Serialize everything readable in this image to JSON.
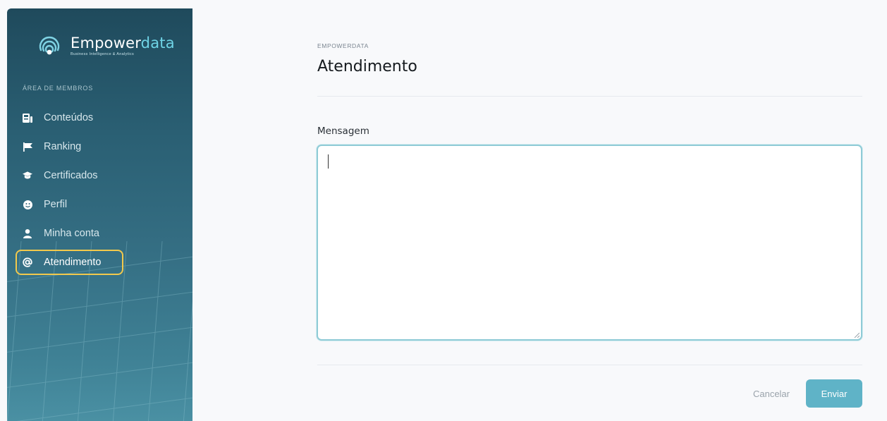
{
  "brand": {
    "name_main": "Empower",
    "name_accent": "data",
    "tagline": "Business Intelligence & Analytics"
  },
  "sidebar": {
    "section_label": "ÁREA DE MEMBROS",
    "items": [
      {
        "label": "Conteúdos",
        "icon": "newspaper-icon",
        "active": false
      },
      {
        "label": "Ranking",
        "icon": "flag-icon",
        "active": false
      },
      {
        "label": "Certificados",
        "icon": "graduation-cap-icon",
        "active": false
      },
      {
        "label": "Perfil",
        "icon": "smiley-icon",
        "active": false
      },
      {
        "label": "Minha conta",
        "icon": "user-icon",
        "active": false
      },
      {
        "label": "Atendimento",
        "icon": "at-sign-icon",
        "active": true
      }
    ]
  },
  "header": {
    "eyebrow": "EMPOWERDATA",
    "title": "Atendimento"
  },
  "form": {
    "message_label": "Mensagem",
    "message_value": "",
    "cancel_label": "Cancelar",
    "send_label": "Enviar"
  },
  "colors": {
    "accent": "#5fb3c7",
    "active_outline": "#f2c94c",
    "sidebar_top": "#1f4a5c",
    "sidebar_bottom": "#4a90a3"
  }
}
